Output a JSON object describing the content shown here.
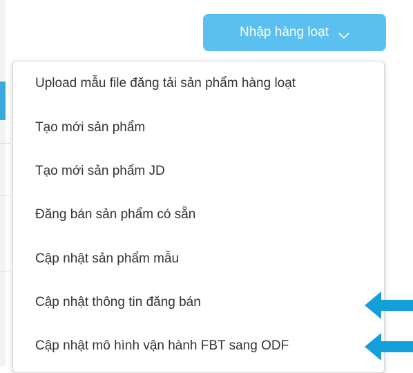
{
  "header": {
    "bulk_button_label": "Nhập hàng loạt",
    "bulk_button_icon": "chevron-down-icon"
  },
  "menu": {
    "items": [
      {
        "label": "Upload mẫu file đăng tải sản phẩm hàng loạt"
      },
      {
        "label": "Tạo mới sản phẩm"
      },
      {
        "label": "Tạo mới sản phẩm JD"
      },
      {
        "label": "Đăng bán sản phẩm có sẵn"
      },
      {
        "label": "Cập nhật sản phẩm mẫu"
      },
      {
        "label": "Cập nhật thông tin đăng bán"
      },
      {
        "label": "Cập nhật mô hình vận hành FBT sang ODF"
      }
    ]
  },
  "annotations": {
    "arrow_icon": "left-arrow-icon",
    "arrow_color": "#139fd8"
  },
  "colors": {
    "button_bg": "#5bc0f0",
    "button_text": "#ffffff",
    "menu_text": "#333333"
  }
}
